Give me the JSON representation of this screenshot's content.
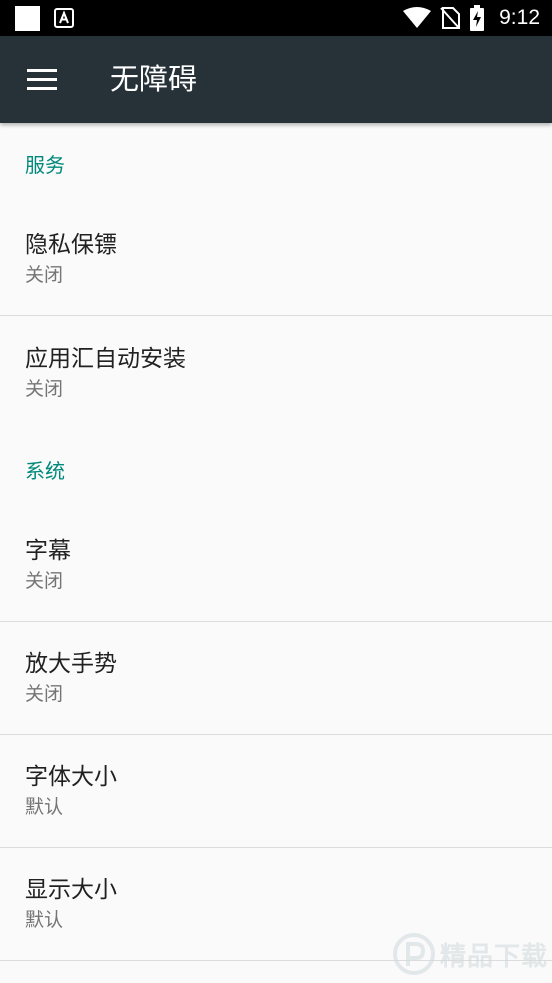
{
  "status_bar": {
    "time": "9:12",
    "icons": [
      "notification-square-icon",
      "notification-a-icon",
      "wifi-icon",
      "no-sim-icon",
      "battery-charging-icon"
    ]
  },
  "app_bar": {
    "title": "无障碍",
    "menu_icon": "hamburger-menu-icon",
    "background": "#263238"
  },
  "accent_color": "#00897b",
  "sections": [
    {
      "header": "服务",
      "items": [
        {
          "title": "隐私保镖",
          "summary": "关闭"
        },
        {
          "title": "应用汇自动安装",
          "summary": "关闭"
        }
      ]
    },
    {
      "header": "系统",
      "items": [
        {
          "title": "字幕",
          "summary": "关闭"
        },
        {
          "title": "放大手势",
          "summary": "关闭"
        },
        {
          "title": "字体大小",
          "summary": "默认"
        },
        {
          "title": "显示大小",
          "summary": "默认"
        }
      ]
    }
  ],
  "watermark": {
    "text": "精品下载",
    "icon": "p-logo-icon"
  }
}
